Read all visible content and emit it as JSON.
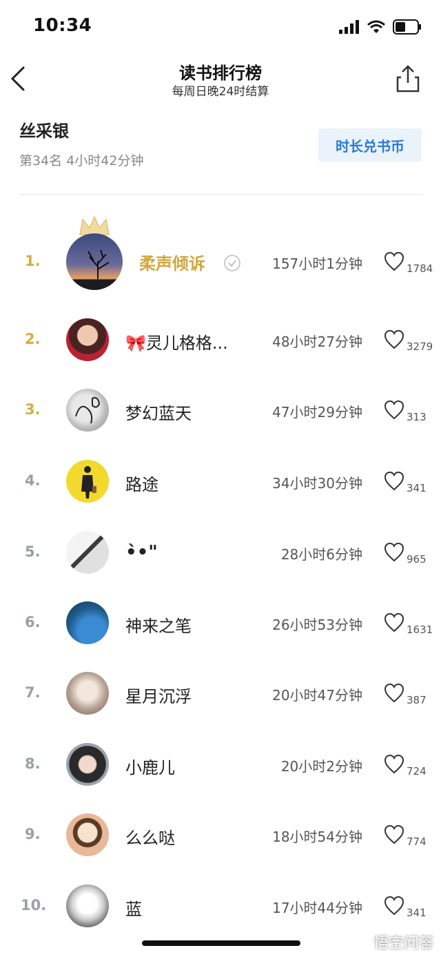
{
  "status": {
    "time": "10:34"
  },
  "nav": {
    "title": "读书排行榜",
    "subtitle": "每周日晚24时结算"
  },
  "me": {
    "name": "丝采银",
    "rank_info": "第34名 4小时42分钟",
    "exchange_label": "时长兑书币"
  },
  "ranking": [
    {
      "rank": "1.",
      "name": "柔声倾诉",
      "duration": "157小时1分钟",
      "likes": "1784"
    },
    {
      "rank": "2.",
      "name": "🎀灵儿格格...",
      "duration": "48小时27分钟",
      "likes": "3279"
    },
    {
      "rank": "3.",
      "name": "梦幻蓝天",
      "duration": "47小时29分钟",
      "likes": "313"
    },
    {
      "rank": "4.",
      "name": "路途",
      "duration": "34小时30分钟",
      "likes": "341"
    },
    {
      "rank": "5.",
      "name": "•̀•\"",
      "duration": "28小时6分钟",
      "likes": "965"
    },
    {
      "rank": "6.",
      "name": "神来之笔",
      "duration": "26小时53分钟",
      "likes": "1631"
    },
    {
      "rank": "7.",
      "name": "星月沉浮",
      "duration": "20小时47分钟",
      "likes": "387"
    },
    {
      "rank": "8.",
      "name": "小鹿儿",
      "duration": "20小时2分钟",
      "likes": "724"
    },
    {
      "rank": "9.",
      "name": "么么哒",
      "duration": "18小时54分钟",
      "likes": "774"
    },
    {
      "rank": "10.",
      "name": "蓝",
      "duration": "17小时44分钟",
      "likes": "341"
    }
  ],
  "watermark": "悟空问答",
  "colors": {
    "gold": "#d6ad3f",
    "accent_blue": "#2a7ad6",
    "button_bg": "#eaf2fb"
  }
}
